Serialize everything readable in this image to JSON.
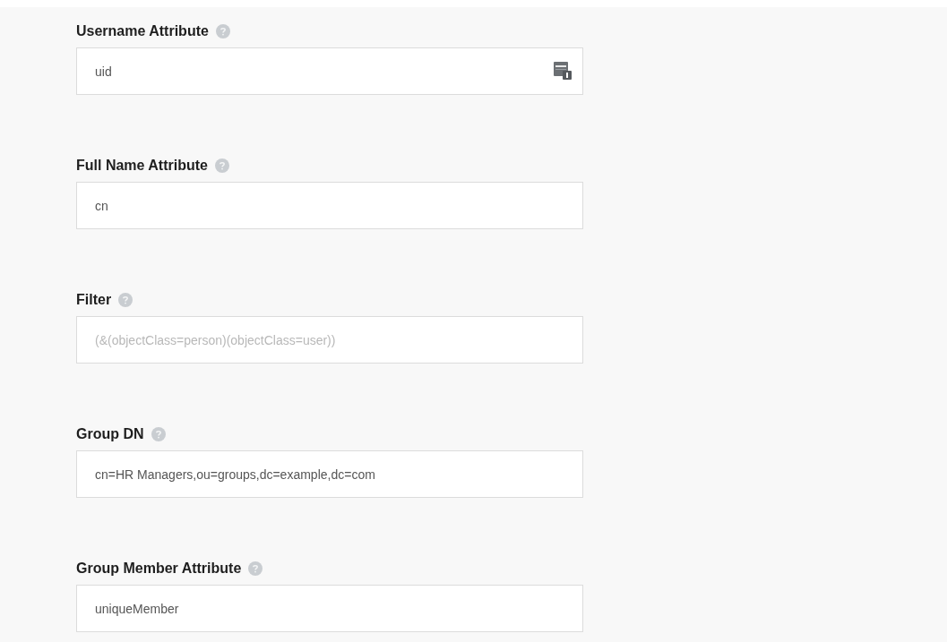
{
  "fields": [
    {
      "label": "Username Attribute",
      "value": "uid",
      "kind": "picker"
    },
    {
      "label": "Full Name Attribute",
      "value": "cn",
      "kind": "text"
    },
    {
      "label": "Filter",
      "placeholder": "(&(objectClass=person)(objectClass=user))",
      "kind": "text"
    },
    {
      "label": "Group DN",
      "value": "cn=HR Managers,ou=groups,dc=example,dc=com",
      "kind": "text"
    },
    {
      "label": "Group Member Attribute",
      "value": "uniqueMember",
      "kind": "text"
    }
  ]
}
